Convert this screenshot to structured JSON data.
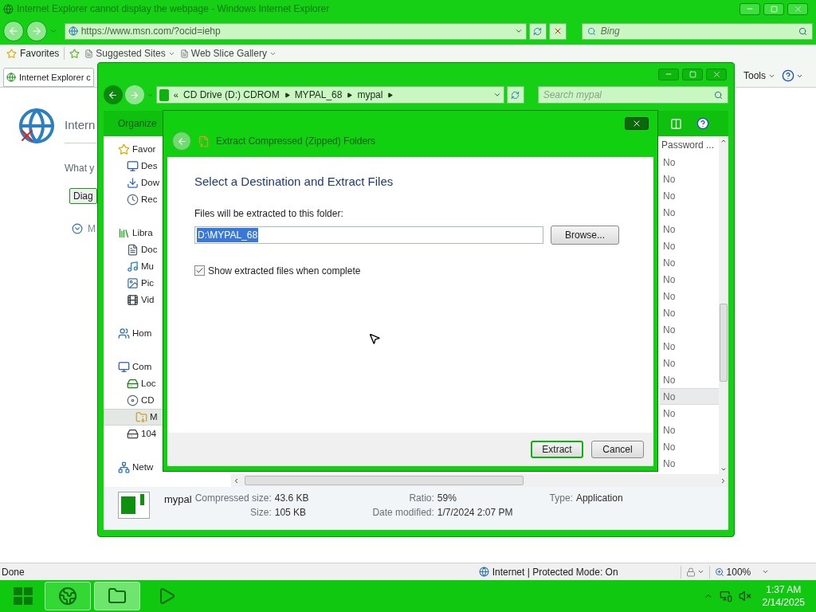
{
  "ie_window": {
    "title": "Internet Explorer cannot display the webpage - Windows Internet Explorer",
    "address": "https://www.msn.com/?ocid=iehp",
    "search_placeholder": "Bing",
    "favorites_label": "Favorites",
    "favorites_links": [
      "Suggested Sites",
      "Web Slice Gallery"
    ],
    "tab_label": "Internet Explorer c",
    "tools_label": "Tools",
    "page": {
      "heading": "Intern",
      "text": "What y",
      "button": "Diag",
      "more": "M"
    },
    "status": {
      "left": "Done",
      "zone": "Internet | Protected Mode: On",
      "zoom": "100%"
    }
  },
  "explorer": {
    "breadcrumb_overflow": "«",
    "breadcrumb": [
      "CD Drive (D:) CDROM",
      "MYPAL_68",
      "mypal"
    ],
    "search_placeholder": "Search mypal",
    "toolbar": [
      "Organize"
    ],
    "nav": [
      {
        "label": "Favor",
        "selected": false,
        "children": [
          {
            "label": "Des",
            "selected": false
          },
          {
            "label": "Dow",
            "selected": false
          },
          {
            "label": "Rec",
            "selected": false
          }
        ]
      },
      {
        "label": "Libra",
        "selected": false,
        "children": [
          {
            "label": "Doc",
            "selected": false
          },
          {
            "label": "Mu",
            "selected": false
          },
          {
            "label": "Pic",
            "selected": false
          },
          {
            "label": "Vid",
            "selected": false
          }
        ]
      },
      {
        "label": "Hom",
        "selected": false
      },
      {
        "label": "Com",
        "selected": false,
        "children": [
          {
            "label": "Loc",
            "selected": false
          },
          {
            "label": "CD",
            "selected": false,
            "children": [
              {
                "label": "M",
                "selected": true
              }
            ]
          },
          {
            "label": "104",
            "selected": false
          }
        ]
      },
      {
        "label": "Netw",
        "selected": false
      }
    ],
    "column_header": "Password ...",
    "rows": [
      {
        "value": "No",
        "selected": false
      },
      {
        "value": "No",
        "selected": false
      },
      {
        "value": "No",
        "selected": false
      },
      {
        "value": "No",
        "selected": false
      },
      {
        "value": "No",
        "selected": false
      },
      {
        "value": "No",
        "selected": false
      },
      {
        "value": "No",
        "selected": false
      },
      {
        "value": "No",
        "selected": false
      },
      {
        "value": "No",
        "selected": false
      },
      {
        "value": "No",
        "selected": false
      },
      {
        "value": "No",
        "selected": false
      },
      {
        "value": "No",
        "selected": false
      },
      {
        "value": "No",
        "selected": false
      },
      {
        "value": "No",
        "selected": false
      },
      {
        "value": "No",
        "selected": true
      },
      {
        "value": "No",
        "selected": false
      },
      {
        "value": "No",
        "selected": false
      },
      {
        "value": "No",
        "selected": false
      },
      {
        "value": "No",
        "selected": false
      }
    ],
    "details": {
      "name": "mypal",
      "columns": [
        [
          {
            "label": "Compressed size:",
            "value": "43.6 KB"
          },
          {
            "label": "Size:",
            "value": "105 KB"
          }
        ],
        [
          {
            "label": "Ratio:",
            "value": "59%"
          },
          {
            "label": "Date modified:",
            "value": "1/7/2024 2:07 PM"
          }
        ],
        [
          {
            "label": "Type:",
            "value": "Application"
          }
        ]
      ]
    }
  },
  "dialog": {
    "title": "Extract Compressed (Zipped) Folders",
    "heading": "Select a Destination and Extract Files",
    "field_label": "Files will be extracted to this folder:",
    "folder": "D:\\MYPAL_68",
    "browse": "Browse...",
    "show_files": {
      "label": "Show extracted files when complete",
      "checked": true
    },
    "buttons": [
      {
        "label": "Extract",
        "default": true
      },
      {
        "label": "Cancel",
        "default": false
      }
    ]
  },
  "taskbar": {
    "apps": [
      {
        "running": true,
        "selected": false
      },
      {
        "running": true,
        "selected": true
      },
      {
        "running": false,
        "selected": false
      }
    ],
    "time": "1:37 AM",
    "date": "2/14/2025"
  }
}
